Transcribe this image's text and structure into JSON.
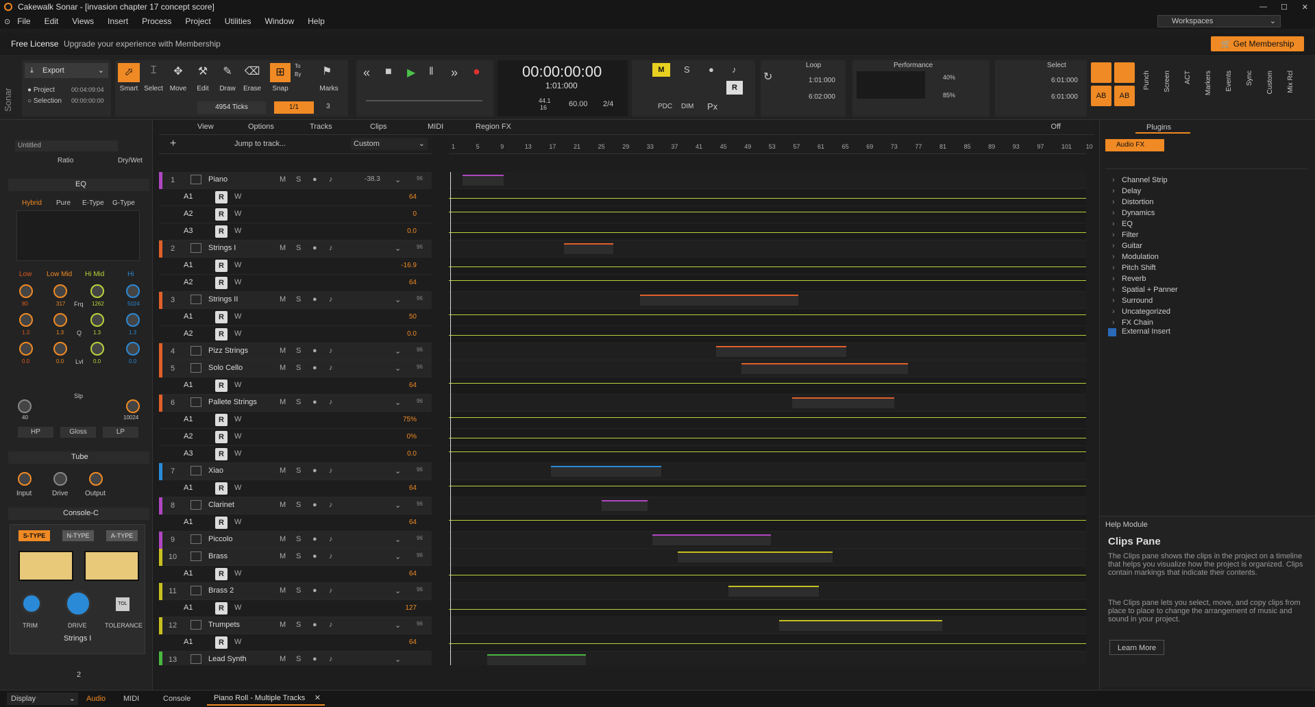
{
  "title": "Cakewalk Sonar - [invasion chapter 17 concept score]",
  "menu": [
    "File",
    "Edit",
    "Views",
    "Insert",
    "Process",
    "Project",
    "Utilities",
    "Window",
    "Help"
  ],
  "workspaces": "Workspaces",
  "membership": {
    "free": "Free License",
    "upgrade": "Upgrade your experience with Membership",
    "button": "Get Membership"
  },
  "tools": {
    "export": "Export",
    "project": "Project",
    "project_time": "00:04:09:04",
    "selection": "Selection",
    "selection_time": "00:00:00:00",
    "smart": "Smart",
    "select": "Select",
    "move": "Move",
    "edit": "Edit",
    "draw": "Draw",
    "erase": "Erase",
    "snap": "Snap",
    "snap_value": "1/1",
    "ticks": "4954 Ticks",
    "to": "To",
    "by": "By",
    "marks": "Marks",
    "snap_num": "3"
  },
  "transport": {
    "time": "00:00:00:00",
    "measure": "1:01:000",
    "rate": "44.1",
    "bits": "16",
    "tempo": "60.00",
    "meter": "2/4"
  },
  "loop": {
    "label": "Loop",
    "start": "1:01:000",
    "end": "6:02:000"
  },
  "performance": {
    "label": "Performance",
    "p1": "40%",
    "p2": "85%"
  },
  "selectbox": {
    "label": "Select",
    "start": "6:01:000",
    "end": "6:01:000"
  },
  "rightbuttons": [
    "Punch",
    "Screen",
    "ACT",
    "Markers",
    "Events",
    "Sync",
    "Custom",
    "Mix Rcl"
  ],
  "leftpanel": {
    "preset": "Untitled",
    "ratio": "Ratio",
    "drywet": "Dry/Wet",
    "eq_title": "EQ",
    "eq_modes": [
      "Hybrid",
      "Pure",
      "E-Type",
      "G-Type"
    ],
    "bands": [
      "Low",
      "Low Mid",
      "Hi Mid",
      "Hi"
    ],
    "freqs": [
      "80",
      "317",
      "1262",
      "5024"
    ],
    "frq": "Frq",
    "q": "Q",
    "lvl": "Lvl",
    "slp": "Slp",
    "qvals": [
      "1.3",
      "1.3",
      "1.3",
      "1.3"
    ],
    "lvals": [
      "0.0",
      "0.0",
      "0.0",
      "0.0"
    ],
    "slope_l": "40",
    "slope_r": "10024",
    "filters": [
      "HP",
      "Gloss",
      "LP"
    ],
    "tube": "Tube",
    "tube_knobs": [
      "Input",
      "Drive",
      "Output"
    ],
    "console": "Console-C",
    "types": [
      "S-TYPE",
      "N-TYPE",
      "A-TYPE"
    ],
    "console_knobs": [
      "TRIM",
      "DRIVE",
      "TOLERANCE"
    ],
    "tol": "TOL",
    "track": "Strings I",
    "tracknum": "2"
  },
  "clipsbar": {
    "view": "View",
    "options": "Options",
    "tracks": "Tracks",
    "clips": "Clips",
    "midi": "MIDI",
    "regionfx": "Region FX",
    "off": "Off",
    "jump": "Jump to track...",
    "custom": "Custom"
  },
  "ruler": [
    "1",
    "5",
    "9",
    "13",
    "17",
    "21",
    "25",
    "29",
    "33",
    "37",
    "41",
    "45",
    "49",
    "53",
    "57",
    "61",
    "65",
    "69",
    "73",
    "77",
    "81",
    "85",
    "89",
    "93",
    "97",
    "101",
    "10"
  ],
  "tracks": [
    {
      "type": "track",
      "num": "1",
      "name": "Piano",
      "color": "#b046c2",
      "vol": "-38.3",
      "vel": "96"
    },
    {
      "type": "lane",
      "name": "A1",
      "val": "64"
    },
    {
      "type": "lane",
      "name": "A2",
      "val": "0"
    },
    {
      "type": "lane",
      "name": "A3",
      "val": "0.0"
    },
    {
      "type": "track",
      "num": "2",
      "name": "Strings I",
      "color": "#e0602a",
      "vol": "",
      "vel": "96"
    },
    {
      "type": "lane",
      "name": "A1",
      "val": "-16.9"
    },
    {
      "type": "lane",
      "name": "A2",
      "val": "64"
    },
    {
      "type": "track",
      "num": "3",
      "name": "Strings II",
      "color": "#e0602a",
      "vol": "",
      "vel": "96"
    },
    {
      "type": "lane",
      "name": "A1",
      "val": "50"
    },
    {
      "type": "lane",
      "name": "A2",
      "val": "0.0"
    },
    {
      "type": "track",
      "num": "4",
      "name": "Pizz Strings",
      "color": "#e0602a",
      "vol": "",
      "vel": "96"
    },
    {
      "type": "track",
      "num": "5",
      "name": "Solo Cello",
      "color": "#e0602a",
      "vol": "",
      "vel": "96"
    },
    {
      "type": "lane",
      "name": "A1",
      "val": "64"
    },
    {
      "type": "track",
      "num": "6",
      "name": "Pallete Strings",
      "color": "#e0602a",
      "vol": "",
      "vel": "96"
    },
    {
      "type": "lane",
      "name": "A1",
      "val": "75%"
    },
    {
      "type": "lane",
      "name": "A2",
      "val": "0%"
    },
    {
      "type": "lane",
      "name": "A3",
      "val": "0.0"
    },
    {
      "type": "track",
      "num": "7",
      "name": "Xiao",
      "color": "#2a8ad8",
      "vol": "",
      "vel": "96"
    },
    {
      "type": "lane",
      "name": "A1",
      "val": "64"
    },
    {
      "type": "track",
      "num": "8",
      "name": "Clarinet",
      "color": "#b046c2",
      "vol": "",
      "vel": "96"
    },
    {
      "type": "lane",
      "name": "A1",
      "val": "64"
    },
    {
      "type": "track",
      "num": "9",
      "name": "Piccolo",
      "color": "#b046c2",
      "vol": "",
      "vel": "96"
    },
    {
      "type": "track",
      "num": "10",
      "name": "Brass",
      "color": "#c8c020",
      "vol": "",
      "vel": "96"
    },
    {
      "type": "lane",
      "name": "A1",
      "val": "64"
    },
    {
      "type": "track",
      "num": "11",
      "name": "Brass 2",
      "color": "#c8c020",
      "vol": "",
      "vel": "96"
    },
    {
      "type": "lane",
      "name": "A1",
      "val": "127"
    },
    {
      "type": "track",
      "num": "12",
      "name": "Trumpets",
      "color": "#c8c020",
      "vol": "",
      "vel": "96"
    },
    {
      "type": "lane",
      "name": "A1",
      "val": "64"
    },
    {
      "type": "track",
      "num": "13",
      "name": "Lead Synth",
      "color": "#4ab840",
      "vol": "",
      "vel": ""
    }
  ],
  "plugins": {
    "tab": "Plugins",
    "audiofx": "Audio FX",
    "items": [
      "Channel Strip",
      "Delay",
      "Distortion",
      "Dynamics",
      "EQ",
      "Filter",
      "Guitar",
      "Modulation",
      "Pitch Shift",
      "Reverb",
      "Spatial + Panner",
      "Surround",
      "Uncategorized",
      "FX Chain"
    ],
    "external": "External Insert"
  },
  "help": {
    "module": "Help Module",
    "title": "Clips Pane",
    "p1": "The Clips pane shows the clips in the project on a timeline that helps you visualize how the project is organized. Clips contain markings that indicate their contents.",
    "p2": "The Clips pane lets you select, move, and copy clips from place to place to change the arrangement of music and sound in your project.",
    "learn": "Learn More"
  },
  "bottom": {
    "display": "Display",
    "audio": "Audio",
    "midi": "MIDI",
    "console": "Console",
    "pianoroll": "Piano Roll - Multiple Tracks"
  },
  "colors": {
    "accent": "#f08a24",
    "lane_green": "#b8d43a"
  },
  "track_letters": {
    "m": "M",
    "s": "S",
    "r": "R",
    "w": "W"
  }
}
